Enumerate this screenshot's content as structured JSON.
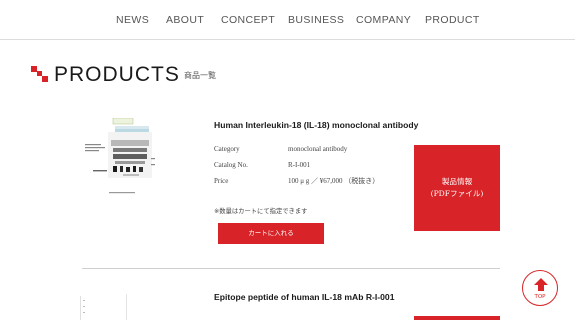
{
  "nav": {
    "items": [
      {
        "label": "NEWS"
      },
      {
        "label": "ABOUT"
      },
      {
        "label": "CONCEPT"
      },
      {
        "label": "BUSINESS"
      },
      {
        "label": "COMPANY"
      },
      {
        "label": "PRODUCT"
      }
    ]
  },
  "page": {
    "title": "PRODUCTS",
    "subtitle": "商品一覧"
  },
  "products": [
    {
      "title": "Human Interleukin-18 (IL-18) monoclonal antibody",
      "specs": [
        {
          "key": "Category",
          "value": "monoclonal antibody"
        },
        {
          "key": "Catalog No.",
          "value": "R-I-001"
        },
        {
          "key": "Price",
          "value": "100 μ g ／ ¥67,000 （税抜き）"
        }
      ],
      "note": "※数量はカートにて指定できます",
      "cart_label": "カートに入れる",
      "pdf_label_line1": "製品情報",
      "pdf_label_line2": "(PDFファイル)"
    },
    {
      "title": "Epitope peptide of human IL-18 mAb R-I-001"
    }
  ],
  "back_to_top": {
    "label": "TOP"
  },
  "colors": {
    "accent": "#d82428",
    "divider": "#cfcfcf",
    "nav_text": "#555555"
  }
}
